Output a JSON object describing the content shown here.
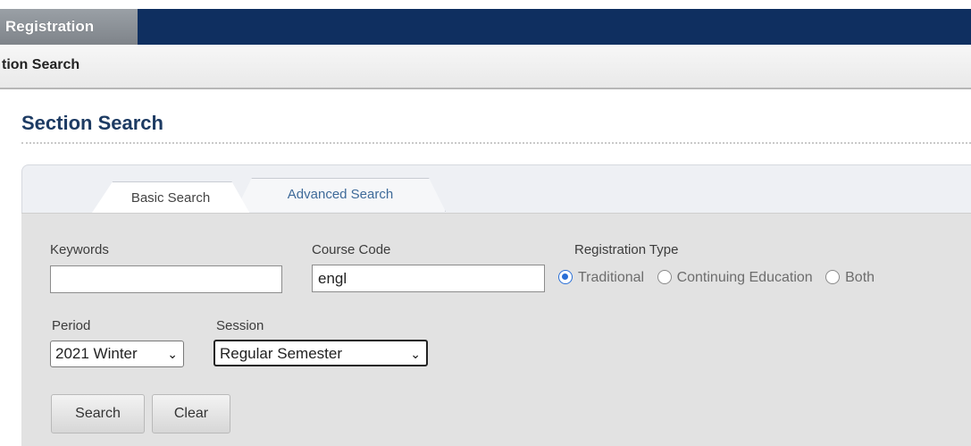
{
  "nav": {
    "active_tab": "Registration"
  },
  "breadcrumb": "tion Search",
  "page": {
    "title": "Section Search"
  },
  "tabs": [
    {
      "label": "Basic Search",
      "active": true
    },
    {
      "label": "Advanced Search",
      "active": false
    }
  ],
  "form": {
    "keywords": {
      "label": "Keywords",
      "value": ""
    },
    "course_code": {
      "label": "Course Code",
      "value": "engl"
    },
    "registration_type": {
      "label": "Registration Type",
      "options": [
        "Traditional",
        "Continuing Education",
        "Both"
      ],
      "selected": "Traditional"
    },
    "period": {
      "label": "Period",
      "value": "2021 Winter"
    },
    "session": {
      "label": "Session",
      "value": "Regular Semester"
    },
    "buttons": {
      "search": "Search",
      "clear": "Clear"
    }
  },
  "colors": {
    "nav_bar": "#0f2f60",
    "title": "#1d3b63",
    "radio_accent": "#2a6fd6"
  }
}
